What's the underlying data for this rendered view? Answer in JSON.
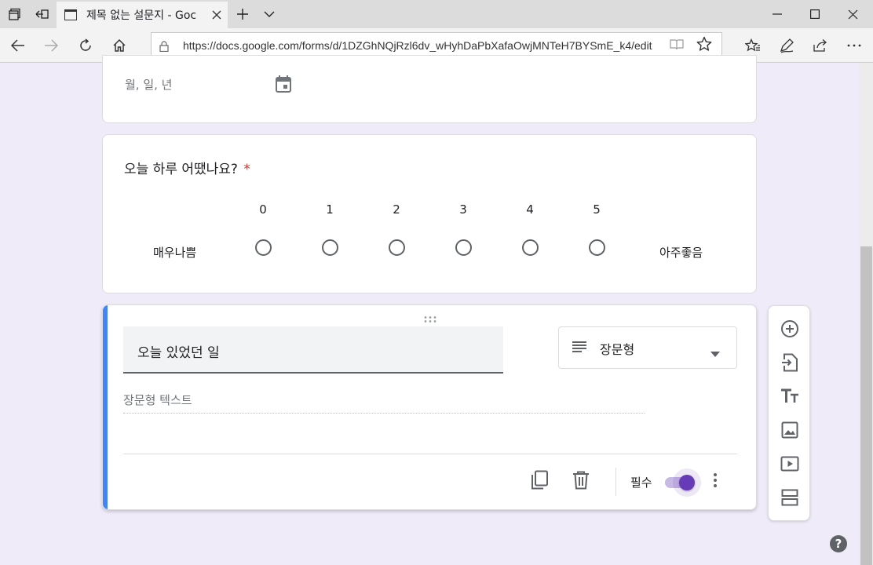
{
  "browser": {
    "tab_title": "제목 없는 설문지 - Goc",
    "url": "https://docs.google.com/forms/d/1DZGhNQjRzl6dv_wHyhDaPbXafaOwjMNTeH7BYSmE_k4/edit"
  },
  "date_question": {
    "placeholder": "월, 일, 년"
  },
  "scale_question": {
    "title": "오늘 하루 어땠나요?",
    "required_mark": "*",
    "scale": [
      "0",
      "1",
      "2",
      "3",
      "4",
      "5"
    ],
    "low_label": "매우나쁨",
    "high_label": "아주좋음"
  },
  "active_question": {
    "title": "오늘 있었던 일",
    "type_label": "장문형",
    "answer_placeholder": "장문형 텍스트",
    "required_label": "필수",
    "required_on": true
  },
  "colors": {
    "accent": "#673ab7",
    "active_bar": "#4285f4",
    "required_star": "#d93025",
    "page_bg": "#f0ebf8"
  },
  "icons": {
    "help": "?"
  }
}
